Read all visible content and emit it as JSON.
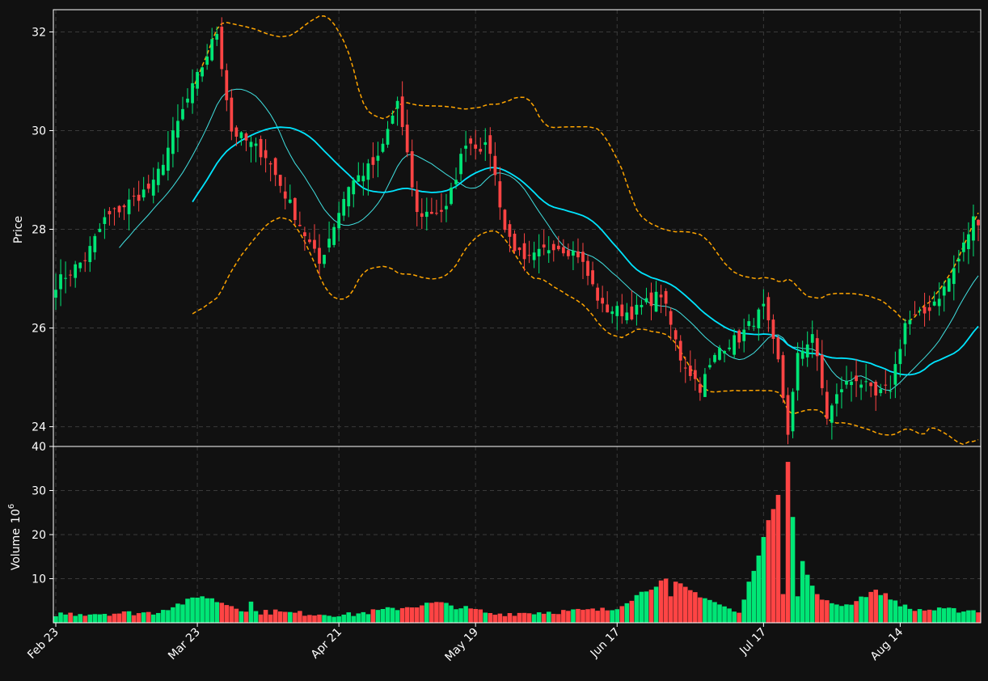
{
  "chart_data": {
    "type": "candlestick",
    "x_tick_labels": [
      "Feb 23",
      "Mar 23",
      "Apr 21",
      "May 19",
      "Jun 17",
      "Jul 17",
      "Aug 14"
    ],
    "x_tick_indices": [
      0,
      29,
      58,
      86,
      115,
      145,
      173
    ],
    "price_panel": {
      "ylabel": "Price",
      "ylim": [
        23.6,
        32.45
      ],
      "yticks": [
        24,
        26,
        28,
        30,
        32
      ],
      "grid": true
    },
    "volume_panel": {
      "ylabel": "Volume",
      "ylabel_unit": "10",
      "ylabel_unit_exp": "6",
      "ylim": [
        0,
        40
      ],
      "yticks": [
        10,
        20,
        30,
        40
      ],
      "grid": true
    },
    "colors": {
      "up": "#00e676",
      "down": "#ff4444",
      "ma_fast": "#40e0e0",
      "ma_slow": "#00e5ff",
      "bollinger": "#ffa500",
      "grid": "#3a3a3a",
      "background": "#111111"
    },
    "key_closes": [
      [
        0,
        26.9
      ],
      [
        6,
        27.4
      ],
      [
        10,
        28.2
      ],
      [
        20,
        28.9
      ],
      [
        26,
        30.4
      ],
      [
        33,
        32.0
      ],
      [
        36,
        30.0
      ],
      [
        43,
        29.5
      ],
      [
        50,
        28.1
      ],
      [
        54,
        27.3
      ],
      [
        57,
        28.1
      ],
      [
        60,
        28.9
      ],
      [
        66,
        29.4
      ],
      [
        70,
        30.6
      ],
      [
        74,
        28.3
      ],
      [
        80,
        28.4
      ],
      [
        84,
        29.8
      ],
      [
        89,
        29.6
      ],
      [
        92,
        28.0
      ],
      [
        96,
        27.3
      ],
      [
        102,
        27.7
      ],
      [
        107,
        27.5
      ],
      [
        112,
        26.4
      ],
      [
        118,
        26.3
      ],
      [
        124,
        26.7
      ],
      [
        128,
        25.4
      ],
      [
        132,
        24.8
      ],
      [
        136,
        25.6
      ],
      [
        140,
        25.8
      ],
      [
        145,
        26.4
      ],
      [
        148,
        25.3
      ],
      [
        150,
        23.9
      ],
      [
        152,
        25.4
      ],
      [
        155,
        25.9
      ],
      [
        158,
        24.2
      ],
      [
        161,
        24.8
      ],
      [
        164,
        25.0
      ],
      [
        168,
        24.6
      ],
      [
        171,
        24.8
      ],
      [
        174,
        26.1
      ],
      [
        178,
        26.3
      ],
      [
        182,
        26.8
      ],
      [
        185,
        27.4
      ],
      [
        188,
        28.2
      ]
    ],
    "volume_points": [
      [
        0,
        2.0
      ],
      [
        20,
        2.3
      ],
      [
        30,
        6.0
      ],
      [
        40,
        2.5
      ],
      [
        60,
        1.8
      ],
      [
        78,
        4.5
      ],
      [
        90,
        2.0
      ],
      [
        114,
        3.0
      ],
      [
        125,
        10.0
      ],
      [
        140,
        2.0
      ],
      [
        150,
        36.5
      ],
      [
        151,
        24.0
      ],
      [
        153,
        14.0
      ],
      [
        156,
        5.0
      ],
      [
        162,
        4.0
      ],
      [
        168,
        7.5
      ],
      [
        175,
        3.0
      ],
      [
        188,
        2.8
      ]
    ],
    "volume_overrides": {
      "30": 6.0,
      "40": 4.8,
      "45": 3.0,
      "89": 2.2,
      "125": 10.0,
      "126": 6.0,
      "149": 6.5,
      "150": 36.5,
      "151": 24.0,
      "152": 6.0,
      "153": 14.0,
      "156": 6.5,
      "168": 7.5
    }
  }
}
